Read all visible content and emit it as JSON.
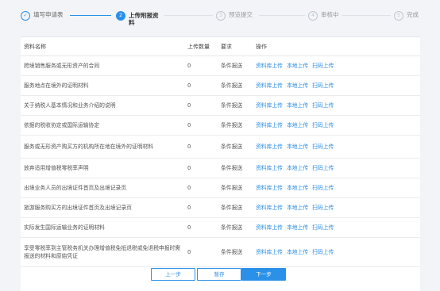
{
  "steps": [
    {
      "label": "填写申请表",
      "number": "1",
      "state": "done",
      "icon": "check-icon"
    },
    {
      "label": "上传附报资料",
      "number": "2",
      "state": "active"
    },
    {
      "label": "预览提交",
      "number": "3",
      "state": "pending"
    },
    {
      "label": "审核中",
      "number": "4",
      "state": "pending"
    },
    {
      "label": "完成",
      "number": "5",
      "state": "pending"
    }
  ],
  "table": {
    "headers": {
      "name": "资料名称",
      "count": "上传数量",
      "req": "要求",
      "ops": "操作"
    },
    "links": {
      "library": "资料库上传",
      "local": "本地上传",
      "scan": "扫码上传"
    },
    "rows": [
      {
        "name": "跨境销售服务或无形资产的合同",
        "count": "0",
        "req": "条件报送"
      },
      {
        "name": "服务地点在境外的证明材料",
        "count": "0",
        "req": "条件报送"
      },
      {
        "name": "关于纳税人基本情况和业务介绍的说明",
        "count": "0",
        "req": "条件报送"
      },
      {
        "name": "依据的税收协定或国际运输协定",
        "count": "0",
        "req": "条件报送"
      },
      {
        "name": "服务或无形资产购买方的机构所在地在境外的证明材料",
        "count": "0",
        "req": "条件报送"
      },
      {
        "name": "放弃适用增值税零税率声明",
        "count": "0",
        "req": "条件报送"
      },
      {
        "name": "出境业务人员的出境证件首页及出境记录页",
        "count": "0",
        "req": "条件报送"
      },
      {
        "name": "旅游服务购买方的出境证件首页及出境记录页",
        "count": "0",
        "req": "条件报送"
      },
      {
        "name": "实际发生国际运输业务的证明材料",
        "count": "0",
        "req": "条件报送"
      },
      {
        "name": "享受零税率到主管税务机关办理增值税免抵退税或免退税申报时需报送的材料和原始凭证",
        "count": "0",
        "req": "条件报送"
      }
    ]
  },
  "buttons": {
    "prev": "上一步",
    "save": "暂存",
    "next": "下一步"
  },
  "colors": {
    "accent": "#2b91e8",
    "link": "#2b8ee6"
  }
}
